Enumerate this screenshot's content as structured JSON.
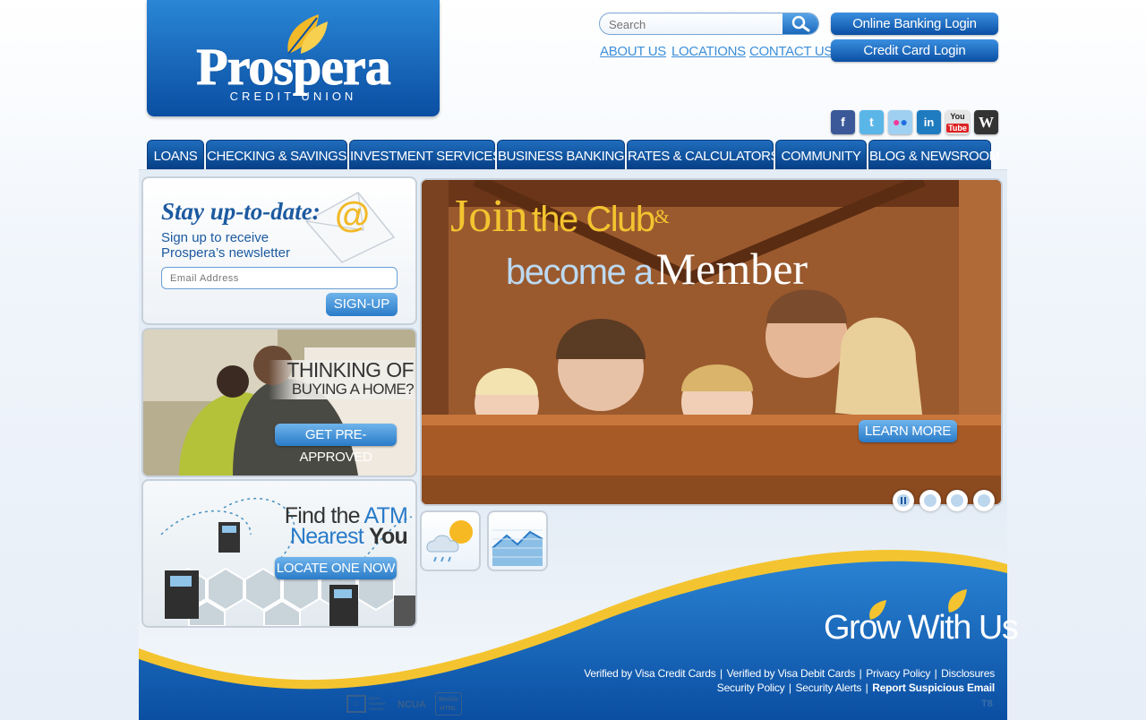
{
  "logo": {
    "name": "Prospera",
    "subtitle": "CREDIT UNION"
  },
  "search": {
    "placeholder": "Search"
  },
  "top_links": [
    "ABOUT US",
    "LOCATIONS",
    "CONTACT US"
  ],
  "login_buttons": [
    "Online Banking Login",
    "Credit Card Login"
  ],
  "social_icons": [
    "facebook-icon",
    "twitter-icon",
    "flickr-icon",
    "linkedin-icon",
    "youtube-icon",
    "wordpress-icon"
  ],
  "nav_tabs": [
    "LOANS",
    "CHECKING & SAVINGS",
    "INVESTMENT SERVICES",
    "BUSINESS BANKING",
    "RATES & CALCULATORS",
    "COMMUNITY",
    "BLOG & NEWSROOM"
  ],
  "newsletter": {
    "title": "Stay up-to-date:",
    "line1": "Sign up to receive",
    "line2": "Prospera’s newsletter",
    "email_placeholder": "Email Address",
    "button": "SIGN-UP"
  },
  "home_promo": {
    "line1": "THINKING OF",
    "line2": "BUYING A HOME?",
    "button": "GET PRE-APPROVED"
  },
  "atm_promo": {
    "find": "Find the",
    "atm": "ATM",
    "nearest": "Nearest",
    "you": "You",
    "button": "LOCATE ONE NOW"
  },
  "hero": {
    "join": "Join",
    "the_club": "the Club",
    "amp": "&",
    "become_a": "become a",
    "member": "Member",
    "button": "LEARN MORE"
  },
  "slider": {
    "pause": "pause-icon",
    "slides": 4
  },
  "tiles": [
    "weather-icon",
    "chart-icon"
  ],
  "tagline": "Grow With Us",
  "footer": {
    "row1": [
      "Verified by Visa Credit Cards",
      "Verified by Visa Debit Cards",
      "Privacy Policy",
      "Disclosures"
    ],
    "row2": [
      "Security Policy",
      "Security Alerts",
      "Report Suspicious Email"
    ],
    "badges": [
      "EQUAL HOUSING LENDER",
      "NCUA",
      "Mobile HTML"
    ],
    "corner": "T8"
  },
  "colors": {
    "brand_blue": "#0a4ea2",
    "accent_gold": "#f4c430",
    "link_blue": "#3d8fd8"
  }
}
